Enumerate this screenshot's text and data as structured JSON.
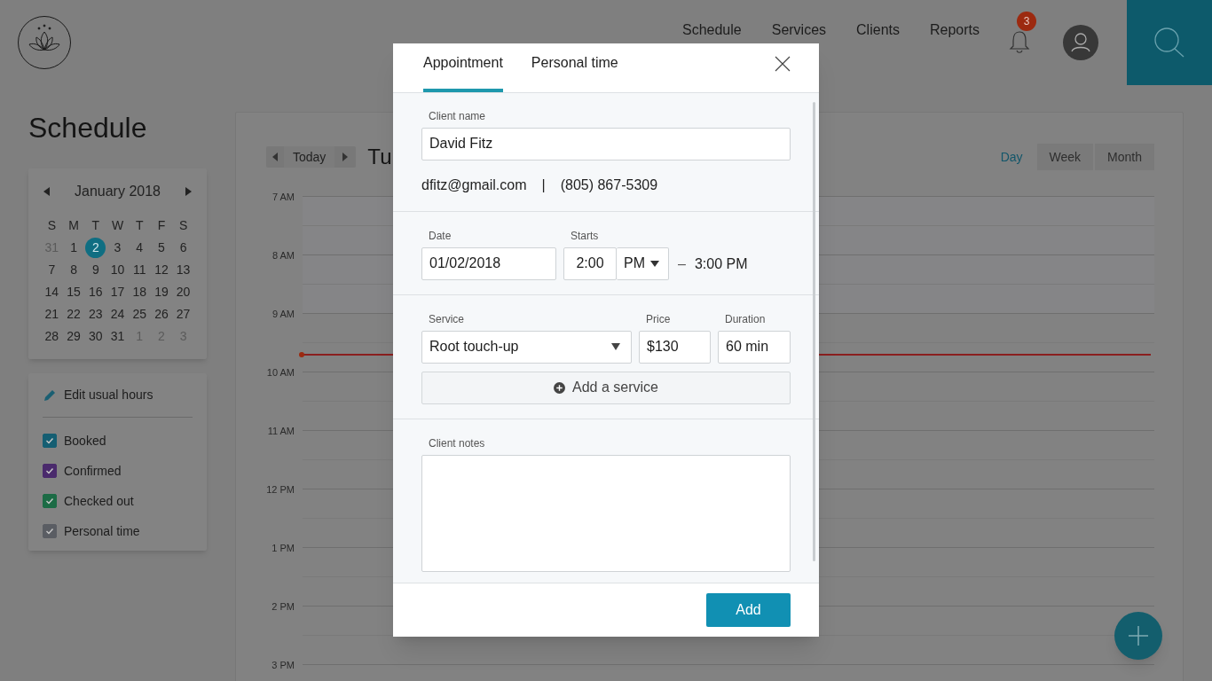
{
  "header": {
    "nav": [
      {
        "label": "Schedule"
      },
      {
        "label": "Services"
      },
      {
        "label": "Clients"
      },
      {
        "label": "Reports"
      }
    ],
    "notification_count": "3"
  },
  "sidebar": {
    "title": "Schedule",
    "mini_calendar": {
      "month": "January 2018",
      "weekdays": [
        "S",
        "M",
        "T",
        "W",
        "T",
        "F",
        "S"
      ],
      "days": [
        {
          "label": "31",
          "muted": true,
          "selected": false
        },
        {
          "label": "1",
          "muted": false,
          "selected": false
        },
        {
          "label": "2",
          "muted": false,
          "selected": true
        },
        {
          "label": "3",
          "muted": false,
          "selected": false
        },
        {
          "label": "4",
          "muted": false,
          "selected": false
        },
        {
          "label": "5",
          "muted": false,
          "selected": false
        },
        {
          "label": "6",
          "muted": false,
          "selected": false
        },
        {
          "label": "7",
          "muted": false,
          "selected": false
        },
        {
          "label": "8",
          "muted": false,
          "selected": false
        },
        {
          "label": "9",
          "muted": false,
          "selected": false
        },
        {
          "label": "10",
          "muted": false,
          "selected": false
        },
        {
          "label": "11",
          "muted": false,
          "selected": false
        },
        {
          "label": "12",
          "muted": false,
          "selected": false
        },
        {
          "label": "13",
          "muted": false,
          "selected": false
        },
        {
          "label": "14",
          "muted": false,
          "selected": false
        },
        {
          "label": "15",
          "muted": false,
          "selected": false
        },
        {
          "label": "16",
          "muted": false,
          "selected": false
        },
        {
          "label": "17",
          "muted": false,
          "selected": false
        },
        {
          "label": "18",
          "muted": false,
          "selected": false
        },
        {
          "label": "19",
          "muted": false,
          "selected": false
        },
        {
          "label": "20",
          "muted": false,
          "selected": false
        },
        {
          "label": "21",
          "muted": false,
          "selected": false
        },
        {
          "label": "22",
          "muted": false,
          "selected": false
        },
        {
          "label": "23",
          "muted": false,
          "selected": false
        },
        {
          "label": "24",
          "muted": false,
          "selected": false
        },
        {
          "label": "25",
          "muted": false,
          "selected": false
        },
        {
          "label": "26",
          "muted": false,
          "selected": false
        },
        {
          "label": "27",
          "muted": false,
          "selected": false
        },
        {
          "label": "28",
          "muted": false,
          "selected": false
        },
        {
          "label": "29",
          "muted": false,
          "selected": false
        },
        {
          "label": "30",
          "muted": false,
          "selected": false
        },
        {
          "label": "31",
          "muted": false,
          "selected": false
        },
        {
          "label": "1",
          "muted": true,
          "selected": false
        },
        {
          "label": "2",
          "muted": true,
          "selected": false
        },
        {
          "label": "3",
          "muted": true,
          "selected": false
        }
      ]
    },
    "edit_hours": "Edit usual hours",
    "filters": [
      {
        "label": "Booked",
        "checked": true,
        "color": "#155e72"
      },
      {
        "label": "Confirmed",
        "checked": true,
        "color": "#4a2a6c"
      },
      {
        "label": "Checked out",
        "checked": true,
        "color": "#1c6b45"
      },
      {
        "label": "Personal time",
        "checked": true,
        "color": "#5a5d63"
      }
    ]
  },
  "calendar": {
    "today_button": "Today",
    "date_title": "Tu",
    "views": [
      {
        "label": "Day",
        "selected": true
      },
      {
        "label": "Week",
        "selected": false
      },
      {
        "label": "Month",
        "selected": false
      }
    ],
    "hours": [
      "7 AM",
      "8 AM",
      "9 AM",
      "10 AM",
      "11 AM",
      "12 PM",
      "1 PM",
      "2 PM",
      "3 PM"
    ]
  },
  "dialog": {
    "tabs": [
      {
        "label": "Appointment",
        "selected": true
      },
      {
        "label": "Personal time",
        "selected": false
      }
    ],
    "client_name": {
      "label": "Client name",
      "value": "David Fitz"
    },
    "email": "dfitz@gmail.com",
    "separator": "|",
    "phone": "(805) 867-5309",
    "date": {
      "label": "Date",
      "value": "01/02/2018"
    },
    "starts": {
      "label": "Starts",
      "time": "2:00",
      "period": "PM"
    },
    "dash": "–",
    "ends": "3:00 PM",
    "service": {
      "label": "Service",
      "value": "Root touch-up"
    },
    "price": {
      "label": "Price",
      "value": "$130"
    },
    "duration": {
      "label": "Duration",
      "value": "60 min"
    },
    "add_service": "Add a service",
    "notes": {
      "label": "Client notes"
    },
    "submit": "Add"
  }
}
